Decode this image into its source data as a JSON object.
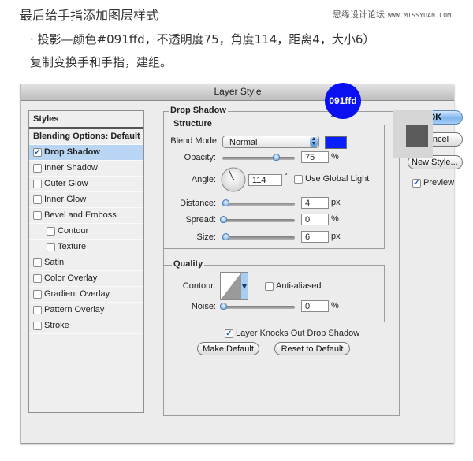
{
  "article": {
    "heading": "最后给手指添加图层样式",
    "watermark_name": "思缘设计论坛",
    "watermark_url": "WWW.MISSYUAN.COM",
    "note_line1": "· 投影—颜色#091ffd，不透明度75，角度114，距离4，大小6）",
    "note_line2": "复制变换手和手指，建组。"
  },
  "dialog": {
    "title": "Layer Style",
    "styles_panel": {
      "header": "Styles",
      "items": [
        {
          "label": "Blending Options: Default",
          "has_checkbox": false,
          "checked": false,
          "selected": false
        },
        {
          "label": "Drop Shadow",
          "has_checkbox": true,
          "checked": true,
          "selected": true
        },
        {
          "label": "Inner Shadow",
          "has_checkbox": true,
          "checked": false
        },
        {
          "label": "Outer Glow",
          "has_checkbox": true,
          "checked": false
        },
        {
          "label": "Inner Glow",
          "has_checkbox": true,
          "checked": false
        },
        {
          "label": "Bevel and Emboss",
          "has_checkbox": true,
          "checked": false
        },
        {
          "label": "Contour",
          "has_checkbox": true,
          "checked": false,
          "indent": true
        },
        {
          "label": "Texture",
          "has_checkbox": true,
          "checked": false,
          "indent": true
        },
        {
          "label": "Satin",
          "has_checkbox": true,
          "checked": false
        },
        {
          "label": "Color Overlay",
          "has_checkbox": true,
          "checked": false
        },
        {
          "label": "Gradient Overlay",
          "has_checkbox": true,
          "checked": false
        },
        {
          "label": "Pattern Overlay",
          "has_checkbox": true,
          "checked": false
        },
        {
          "label": "Stroke",
          "has_checkbox": true,
          "checked": false
        }
      ]
    },
    "drop_shadow": {
      "section_title": "Drop Shadow",
      "structure": {
        "title": "Structure",
        "blend_mode_label": "Blend Mode:",
        "blend_mode_value": "Normal",
        "shadow_color": "#091ffd",
        "opacity_label": "Opacity:",
        "opacity_value": "75",
        "opacity_unit": "%",
        "opacity_fraction": 0.75,
        "angle_label": "Angle:",
        "angle_value": "114",
        "angle_unit": "°",
        "use_global_light_label": "Use Global Light",
        "use_global_light_checked": false,
        "distance_label": "Distance:",
        "distance_value": "4",
        "distance_unit": "px",
        "spread_label": "Spread:",
        "spread_value": "0",
        "spread_unit": "%",
        "size_label": "Size:",
        "size_value": "6",
        "size_unit": "px"
      },
      "quality": {
        "title": "Quality",
        "contour_label": "Contour:",
        "anti_aliased_label": "Anti-aliased",
        "anti_aliased_checked": false,
        "noise_label": "Noise:",
        "noise_value": "0",
        "noise_unit": "%"
      },
      "knockout_label": "Layer Knocks Out Drop Shadow",
      "knockout_checked": true,
      "make_default_label": "Make Default",
      "reset_default_label": "Reset to Default"
    },
    "buttons": {
      "ok": "OK",
      "cancel": "Cancel",
      "new_style": "New Style...",
      "preview_label": "Preview",
      "preview_checked": true
    },
    "callout": {
      "text": "091ffd",
      "color": "#0a10f0"
    }
  }
}
